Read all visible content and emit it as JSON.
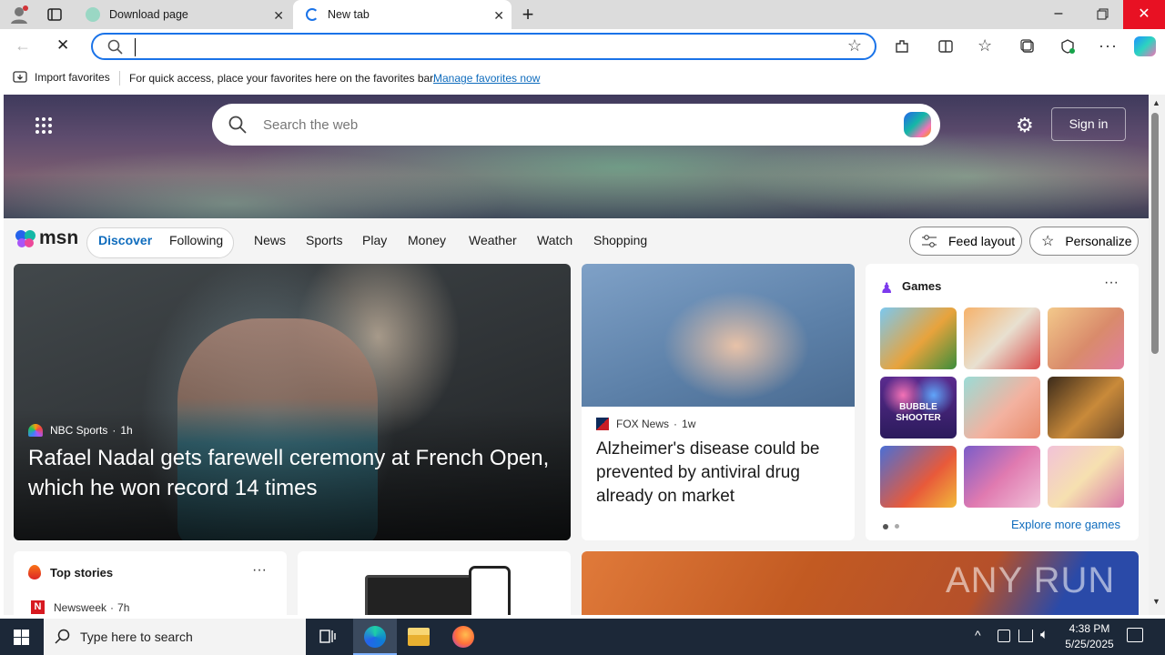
{
  "browser": {
    "tabs": [
      {
        "title": "Download page",
        "active": false
      },
      {
        "title": "New tab",
        "active": true
      }
    ],
    "address_value": "",
    "favorites_bar": {
      "import_label": "Import favorites",
      "message": "For quick access, place your favorites here on the favorites bar.",
      "manage_link": "Manage favorites now"
    }
  },
  "msn": {
    "search_placeholder": "Search the web",
    "sign_in": "Sign in",
    "logo": "msn",
    "pills": [
      "Discover",
      "Following"
    ],
    "nav": [
      "News",
      "Sports",
      "Play",
      "Money",
      "Weather",
      "Watch",
      "Shopping"
    ],
    "feed_layout": "Feed layout",
    "personalize": "Personalize",
    "hero_story": {
      "source": "NBC Sports",
      "time": "1h",
      "headline": "Rafael Nadal gets farewell ceremony at French Open, which he won record 14 times"
    },
    "second_story": {
      "source": "FOX News",
      "time": "1w",
      "headline": "Alzheimer's disease could be prevented by antiviral drug already on market"
    },
    "games": {
      "title": "Games",
      "more_link": "Explore more games",
      "tile_text": "BUBBLE SHOOTER"
    },
    "top_stories": {
      "title": "Top stories",
      "first_source": "Newsweek",
      "first_time": "7h"
    },
    "watermark": "ANY RUN"
  },
  "taskbar": {
    "search_placeholder": "Type here to search",
    "time": "4:38 PM",
    "date": "5/25/2025"
  },
  "colors": {
    "accent": "#0f6cbd",
    "taskbar": "#1c2838"
  }
}
